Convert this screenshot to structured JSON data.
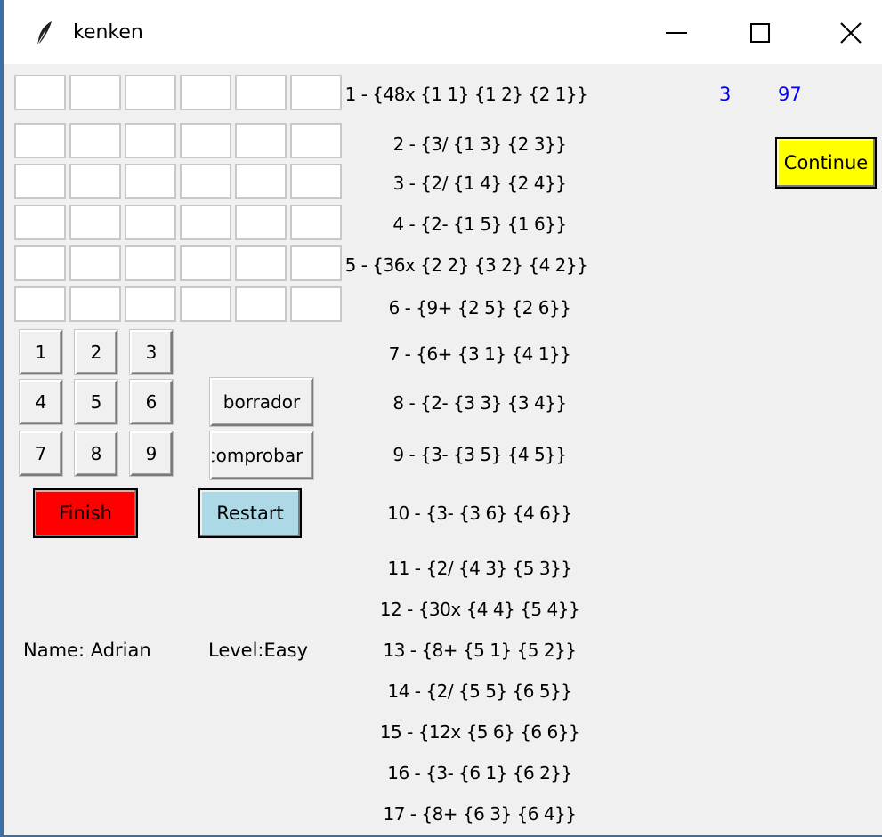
{
  "window": {
    "title": "kenken"
  },
  "keypad": [
    "1",
    "2",
    "3",
    "4",
    "5",
    "6",
    "7",
    "8",
    "9"
  ],
  "actions": {
    "eraser": "borrador",
    "check": "comprobar",
    "finish": "Finish",
    "restart": "Restart",
    "continue": "Continue"
  },
  "colors": {
    "finish": "#ff0000",
    "restart": "#add8e6",
    "continue": "#ffff00",
    "counter": "#0000ff"
  },
  "player": {
    "name": "Name: Adrian",
    "level": "Level:Easy"
  },
  "counters": {
    "left": "3",
    "right": "97"
  },
  "cages": [
    "1 - {48x {1 1} {1 2} {2 1}}",
    "2 - {3/ {1 3} {2 3}}",
    "3 - {2/ {1 4} {2 4}}",
    "4 - {2- {1 5} {1 6}}",
    "5 - {36x {2 2} {3 2} {4 2}}",
    "6 - {9+ {2 5} {2 6}}",
    "7 - {6+ {3 1} {4 1}}",
    "8 - {2- {3 3} {3 4}}",
    "9 - {3- {3 5} {4 5}}",
    "10 - {3- {3 6} {4 6}}",
    "11 - {2/ {4 3} {5 3}}",
    "12 - {30x {4 4} {5 4}}",
    "13 - {8+ {5 1} {5 2}}",
    "14 - {2/ {5 5} {6 5}}",
    "15 - {12x {5 6} {6 6}}",
    "16 - {3- {6 1} {6 2}}",
    "17 - {8+ {6 3} {6 4}}"
  ]
}
